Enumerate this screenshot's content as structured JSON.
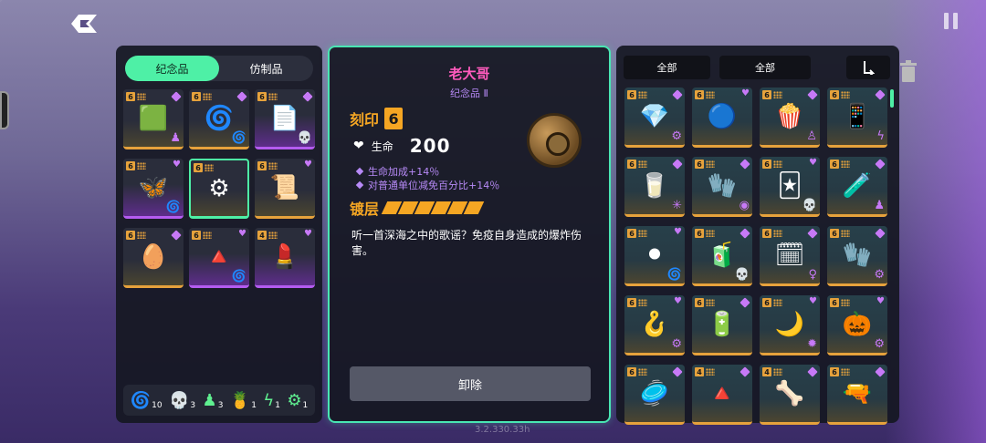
{
  "tabs": {
    "memorial": "纪念品",
    "replica": "仿制品"
  },
  "detail": {
    "name": "老大哥",
    "subtitle": "纪念品 Ⅱ",
    "imprint_label": "刻印",
    "imprint_value": "6",
    "hp_label": "生命",
    "hp_value": "200",
    "bonus_1": "生命加成+14％",
    "bonus_2": "对普通单位减免百分比+14％",
    "coating_label": "镀层",
    "coating_pips": 6,
    "description": "听一首深海之中的歌谣？免疫自身造成的爆炸伤害。",
    "remove_button": "卸除"
  },
  "filters": {
    "filter_1": "全部",
    "filter_2": "全部"
  },
  "stats": [
    {
      "icon": "spiral-icon",
      "count": "10"
    },
    {
      "icon": "skull-icon",
      "count": "3"
    },
    {
      "icon": "worm-icon",
      "count": "3"
    },
    {
      "icon": "pineapple-icon",
      "count": "1"
    },
    {
      "icon": "rune-icon",
      "count": "1"
    },
    {
      "icon": "gear-icon",
      "count": "1"
    }
  ],
  "left_cards": [
    {
      "level": "6",
      "item": "🟩",
      "badge": "♟",
      "style": "",
      "mark": "tag"
    },
    {
      "level": "6",
      "item": "🌀",
      "badge": "🌀",
      "style": "",
      "mark": "tag"
    },
    {
      "level": "6",
      "item": "📄",
      "badge": "💀",
      "style": "purple",
      "mark": "tag"
    },
    {
      "level": "6",
      "item": "🦋",
      "badge": "🌀",
      "style": "purple",
      "mark": "heart"
    },
    {
      "level": "6",
      "item": "⚙",
      "badge": "",
      "style": "selected",
      "mark": ""
    },
    {
      "level": "6",
      "item": "📜",
      "badge": "",
      "style": "",
      "mark": "heart"
    },
    {
      "level": "6",
      "item": "🥚",
      "badge": "",
      "style": "",
      "mark": "tag"
    },
    {
      "level": "6",
      "item": "🔺",
      "badge": "🌀",
      "style": "purple",
      "mark": "heart"
    },
    {
      "level": "4",
      "item": "💄",
      "badge": "",
      "style": "purple",
      "mark": "heart"
    }
  ],
  "right_cards": [
    {
      "level": "6",
      "item": "💎",
      "badge": "⚙",
      "mark": "tag"
    },
    {
      "level": "6",
      "item": "🔵",
      "badge": "",
      "mark": "heart"
    },
    {
      "level": "6",
      "item": "🍿",
      "badge": "♙",
      "mark": "tag"
    },
    {
      "level": "6",
      "item": "📱",
      "badge": "ϟ",
      "mark": "tag"
    },
    {
      "level": "6",
      "item": "🥛",
      "badge": "✳",
      "mark": "tag"
    },
    {
      "level": "6",
      "item": "🧤",
      "badge": "◉",
      "mark": "tag"
    },
    {
      "level": "6",
      "item": "🃏",
      "badge": "💀",
      "mark": "heart"
    },
    {
      "level": "6",
      "item": "🧪",
      "badge": "♟",
      "mark": "tag"
    },
    {
      "level": "6",
      "item": "⚫",
      "badge": "🌀",
      "mark": "heart"
    },
    {
      "level": "6",
      "item": "🧃",
      "badge": "💀",
      "mark": "tag"
    },
    {
      "level": "6",
      "item": "🗓",
      "badge": "♀",
      "mark": "tag"
    },
    {
      "level": "6",
      "item": "🧤",
      "badge": "⚙",
      "mark": "tag"
    },
    {
      "level": "6",
      "item": "🪝",
      "badge": "⚙",
      "mark": "heart"
    },
    {
      "level": "6",
      "item": "🔋",
      "badge": "",
      "mark": "tag"
    },
    {
      "level": "6",
      "item": "🌙",
      "badge": "✹",
      "mark": "heart"
    },
    {
      "level": "6",
      "item": "🎃",
      "badge": "⚙",
      "mark": "heart"
    },
    {
      "level": "6",
      "item": "🥏",
      "badge": "",
      "mark": "tag"
    },
    {
      "level": "4",
      "item": "🔺",
      "badge": "",
      "mark": "tag"
    },
    {
      "level": "4",
      "item": "🦴",
      "badge": "",
      "mark": "tag"
    },
    {
      "level": "6",
      "item": "🔫",
      "badge": "",
      "mark": "tag"
    }
  ],
  "version": "3.2.330.33h",
  "colors": {
    "accent": "#4ef0a6",
    "gold": "#f5a623",
    "purple": "#b78af7",
    "pink": "#ff5bbd"
  }
}
